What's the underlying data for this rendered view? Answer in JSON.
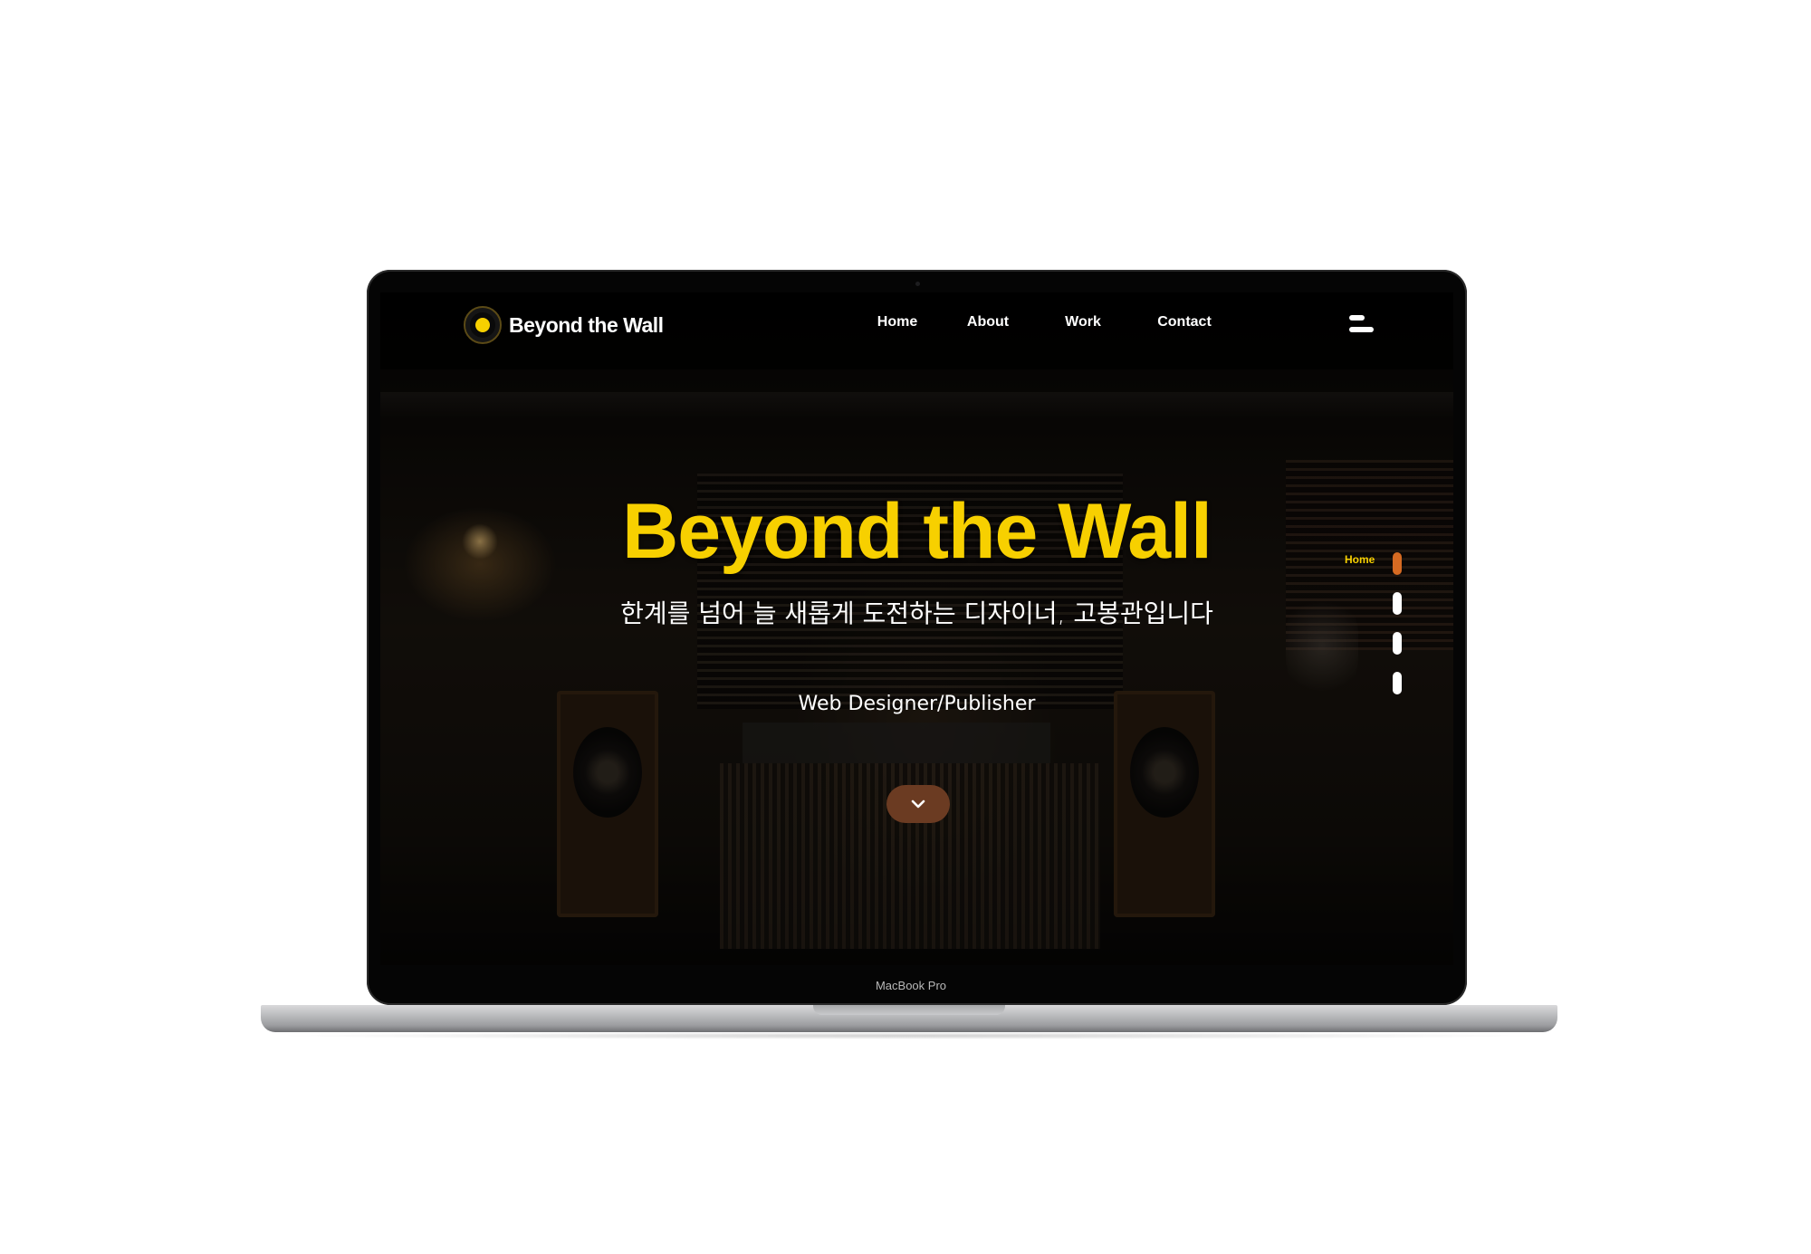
{
  "device": {
    "model_label": "MacBook Pro"
  },
  "header": {
    "logo_text": "Beyond the Wall",
    "nav": [
      {
        "label": "Home"
      },
      {
        "label": "About"
      },
      {
        "label": "Work"
      },
      {
        "label": "Contact"
      }
    ],
    "menu_icon": "hamburger-menu-icon"
  },
  "hero": {
    "title": "Beyond the Wall",
    "subtitle": "한계를 넘어 늘 새롭게 도전하는 디자이너, 고봉관입니다",
    "role": "Web Designer/Publisher",
    "scroll_icon": "chevron-down-icon"
  },
  "side_nav": {
    "active_label": "Home",
    "dot_count": 4,
    "active_index": 0
  },
  "colors": {
    "accent_yellow": "#f7d000",
    "accent_orange": "#d56a22",
    "scroll_button": "#6b3b22"
  }
}
